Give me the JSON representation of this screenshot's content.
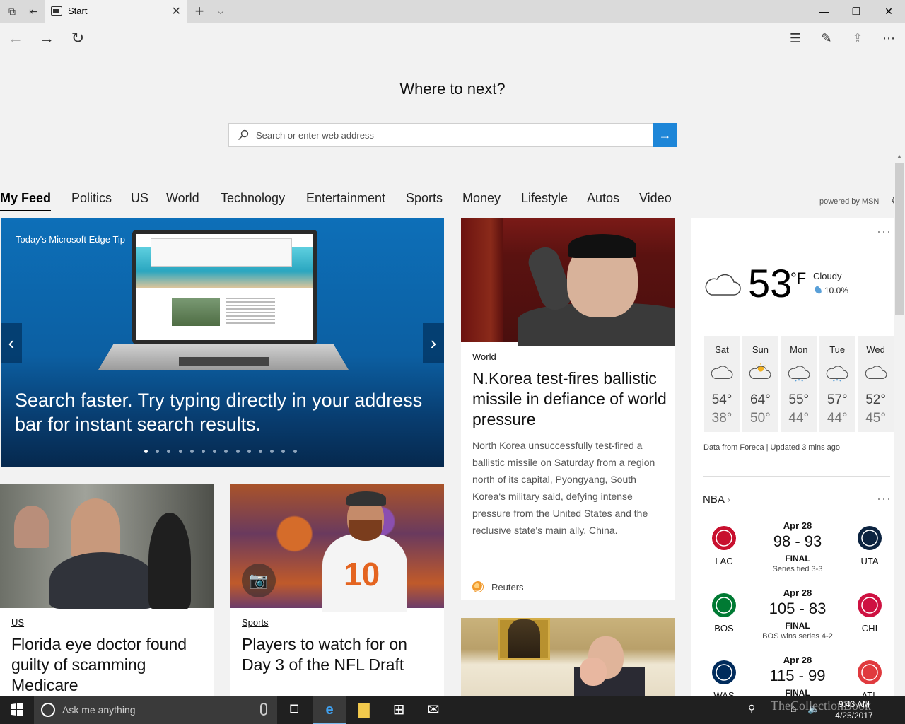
{
  "tab": {
    "title": "Start"
  },
  "start": {
    "heading": "Where to next?",
    "search_placeholder": "Search or enter web address"
  },
  "categories": [
    "My Feed",
    "Politics",
    "US",
    "World",
    "Technology",
    "Entertainment",
    "Sports",
    "Money",
    "Lifestyle",
    "Autos",
    "Video"
  ],
  "powered_by": "powered by MSN",
  "hero": {
    "tag": "Today's Microsoft Edge Tip",
    "headline": "Search faster. Try typing directly in your address bar for instant search results.",
    "slide_count": 14,
    "active_slide": 1
  },
  "stories": {
    "korea": {
      "category": "World",
      "title": "N.Korea test-fires ballistic missile in defiance of world pressure",
      "body": "North Korea unsuccessfully test-fired a ballistic missile on Saturday from a region north of its capital, Pyongyang, South Korea's military said, defying intense pressure from the United States and the reclusive state's main ally, China.",
      "source": "Reuters"
    },
    "doctor": {
      "category": "US",
      "title": "Florida eye doctor found guilty of scamming Medicare"
    },
    "nfl": {
      "category": "Sports",
      "title": "Players to watch for on Day 3 of the NFL Draft"
    }
  },
  "weather": {
    "temp": "53",
    "unit": "°F",
    "condition": "Cloudy",
    "precip": "10.0%",
    "forecast": [
      {
        "day": "Sat",
        "hi": "54°",
        "lo": "38°",
        "icon": "cloudy-icon"
      },
      {
        "day": "Sun",
        "hi": "64°",
        "lo": "50°",
        "icon": "partly-sunny-icon"
      },
      {
        "day": "Mon",
        "hi": "55°",
        "lo": "44°",
        "icon": "rain-icon"
      },
      {
        "day": "Tue",
        "hi": "57°",
        "lo": "44°",
        "icon": "rain-icon"
      },
      {
        "day": "Wed",
        "hi": "52°",
        "lo": "45°",
        "icon": "cloudy-icon"
      }
    ],
    "footer": "Data from Foreca | Updated 3 mins ago"
  },
  "nba": {
    "title": "NBA",
    "games": [
      {
        "date": "Apr 28",
        "score": "98 - 93",
        "status": "FINAL",
        "note": "Series tied 3-3",
        "home": "LAC",
        "away": "UTA",
        "home_color": "#c8102e",
        "away_color": "#0c2340"
      },
      {
        "date": "Apr 28",
        "score": "105 - 83",
        "status": "FINAL",
        "note": "BOS wins series 4-2",
        "home": "BOS",
        "away": "CHI",
        "home_color": "#007a33",
        "away_color": "#ce1141"
      },
      {
        "date": "Apr 28",
        "score": "115 - 99",
        "status": "FINAL",
        "note": "",
        "home": "WAS",
        "away": "ATL",
        "home_color": "#002b5c",
        "away_color": "#e03a3e"
      }
    ]
  },
  "taskbar": {
    "search_text": "Ask me anything",
    "time": "9:43 AM",
    "date": "4/25/2017",
    "watermark": "TheCollectionBook"
  }
}
